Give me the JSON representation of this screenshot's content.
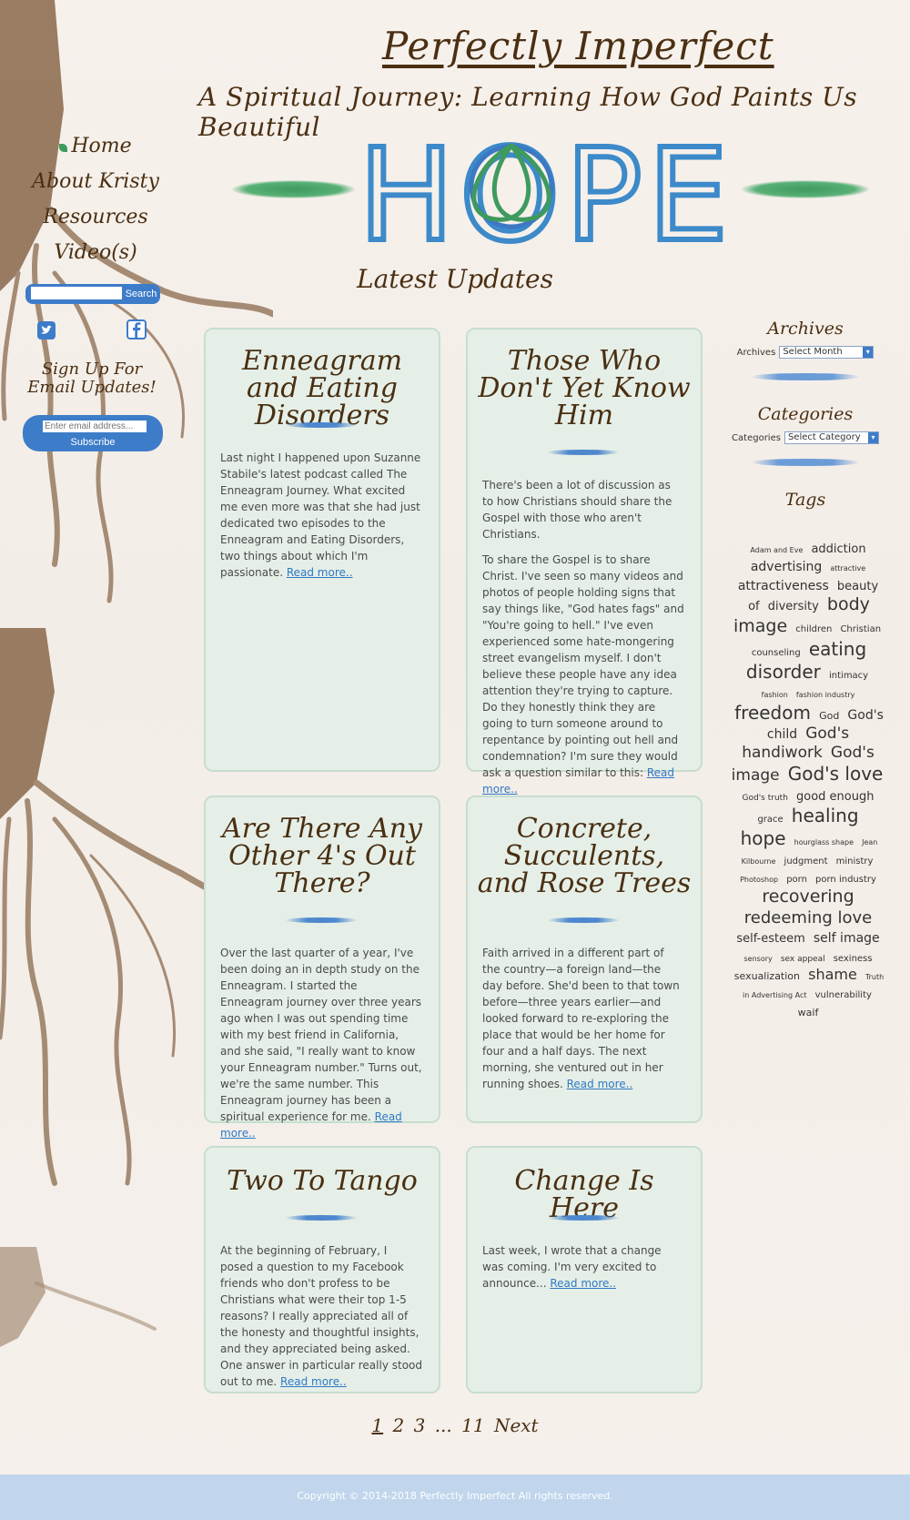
{
  "site": {
    "title": "Perfectly Imperfect",
    "tagline": "A Spiritual Journey: Learning How God Paints Us Beautiful",
    "banner_word": "HOPE",
    "section_heading": "Latest Updates"
  },
  "nav": {
    "items": [
      {
        "label": "Home",
        "active": true
      },
      {
        "label": "About Kristy"
      },
      {
        "label": "Resources"
      },
      {
        "label": "Video(s)"
      }
    ]
  },
  "search": {
    "placeholder": "",
    "button_label": "Search"
  },
  "social": {
    "icons": [
      "twitter-icon",
      "facebook-icon"
    ]
  },
  "signup": {
    "heading": "Sign Up For Email Updates!",
    "email_placeholder": "Enter email address...",
    "button_label": "Subscribe"
  },
  "posts": [
    {
      "title": "Enneagram and Eating Disorders",
      "paragraphs": [
        "Last night I happened upon Suzanne Stabile's latest podcast called The Enneagram Journey. What excited me even more was that she had just dedicated two episodes to the Enneagram and Eating Disorders, two things about which I'm passionate."
      ],
      "read_more": "Read more.."
    },
    {
      "title": "Those Who Don't Yet Know Him",
      "paragraphs": [
        "There's been a lot of discussion as to how Christians should share the Gospel with those who aren't Christians.",
        "To share the Gospel is to share Christ. I've seen so many videos and photos of people holding signs that say things like, \"God hates fags\" and \"You're going to hell.\" I've even experienced some hate-mongering street evangelism myself. I don't believe these people have any idea attention they're trying to capture. Do they honestly think they are going to turn someone around to repentance by pointing out hell and condemnation? I'm sure they would ask a question similar to this:"
      ],
      "read_more": "Read more.."
    },
    {
      "title": "Are There Any Other 4's Out There?",
      "paragraphs": [
        "Over the last quarter of a year, I've been doing an in depth study on the Enneagram. I started the Enneagram journey over three years ago when I was out spending time with my best friend in California, and she said, \"I really want to know your Enneagram number.\" Turns out, we're the same number. This Enneagram journey has been a spiritual experience for me."
      ],
      "read_more": "Read more.."
    },
    {
      "title": "Concrete, Succulents, and Rose Trees",
      "paragraphs": [
        "Faith arrived in a different part of the country—a foreign land—the day before. She'd been to that town before—three years earlier—and looked forward to re-exploring the place that would be her home for four and a half days. The next morning, she ventured out in her running shoes."
      ],
      "read_more": "Read more.."
    },
    {
      "title": "Two To Tango",
      "paragraphs": [
        "At the beginning of February, I posed a question to my Facebook friends who don't profess to be Christians what were their top 1-5 reasons? I really appreciated all of the honesty and thoughtful insights, and they appreciated being asked. One answer in particular really stood out to me."
      ],
      "read_more": "Read more.."
    },
    {
      "title": "Change Is Here",
      "paragraphs": [
        "Last week, I wrote that a change was coming. I'm very excited to announce..."
      ],
      "read_more": "Read more.."
    }
  ],
  "sidebar": {
    "archives_title": "Archives",
    "archives_label": "Archives",
    "archives_select": "Select Month",
    "categories_title": "Categories",
    "categories_label": "Categories",
    "categories_select": "Select Category",
    "tags_title": "Tags",
    "tags": [
      {
        "text": "Adam and Eve",
        "size": 8
      },
      {
        "text": "addiction",
        "size": 13
      },
      {
        "text": "advertising",
        "size": 14
      },
      {
        "text": "attractive",
        "size": 8
      },
      {
        "text": "attractiveness",
        "size": 14
      },
      {
        "text": "beauty",
        "size": 13
      },
      {
        "text": "of",
        "size": 13
      },
      {
        "text": "diversity",
        "size": 13
      },
      {
        "text": "body image",
        "size": 19
      },
      {
        "text": "children",
        "size": 10
      },
      {
        "text": "Christian",
        "size": 10
      },
      {
        "text": "counseling",
        "size": 10
      },
      {
        "text": "eating disorder",
        "size": 20
      },
      {
        "text": "intimacy",
        "size": 10
      },
      {
        "text": "fashion",
        "size": 8
      },
      {
        "text": "fashion industry",
        "size": 8
      },
      {
        "text": "freedom",
        "size": 20
      },
      {
        "text": "God",
        "size": 11
      },
      {
        "text": "God's child",
        "size": 14
      },
      {
        "text": "God's handiwork",
        "size": 17
      },
      {
        "text": "God's image",
        "size": 17
      },
      {
        "text": "God's love",
        "size": 20
      },
      {
        "text": "God's truth",
        "size": 9
      },
      {
        "text": "good enough",
        "size": 13
      },
      {
        "text": "grace",
        "size": 10
      },
      {
        "text": "healing",
        "size": 20
      },
      {
        "text": "hope",
        "size": 20
      },
      {
        "text": "hourglass shape",
        "size": 8
      },
      {
        "text": "Jean Kilbourne",
        "size": 8
      },
      {
        "text": "judgment",
        "size": 10
      },
      {
        "text": "ministry",
        "size": 10
      },
      {
        "text": "Photoshop",
        "size": 8
      },
      {
        "text": "porn",
        "size": 10
      },
      {
        "text": "porn industry",
        "size": 10
      },
      {
        "text": "recovering",
        "size": 19
      },
      {
        "text": "redeeming love",
        "size": 18
      },
      {
        "text": "self-esteem",
        "size": 13
      },
      {
        "text": "self image",
        "size": 14
      },
      {
        "text": "sensory",
        "size": 8
      },
      {
        "text": "sex appeal",
        "size": 9
      },
      {
        "text": "sexiness",
        "size": 10
      },
      {
        "text": "sexualization",
        "size": 11
      },
      {
        "text": "shame",
        "size": 16
      },
      {
        "text": "Truth in Advertising Act",
        "size": 8
      },
      {
        "text": "vulnerability",
        "size": 10
      },
      {
        "text": "waif",
        "size": 11
      }
    ]
  },
  "pagination": {
    "current": "1",
    "pages": [
      "2",
      "3"
    ],
    "ellipsis": "...",
    "last": "11",
    "next": "Next"
  },
  "footer": {
    "copyright": "Copyright © 2014-2018 Perfectly Imperfect All rights reserved."
  },
  "colors": {
    "accent_blue": "#3d7cc9",
    "leaf_green": "#3f9a5e",
    "card_bg": "#e5efe7",
    "footer_bg": "#c1d6ec",
    "text_brown": "#4a2f12"
  }
}
